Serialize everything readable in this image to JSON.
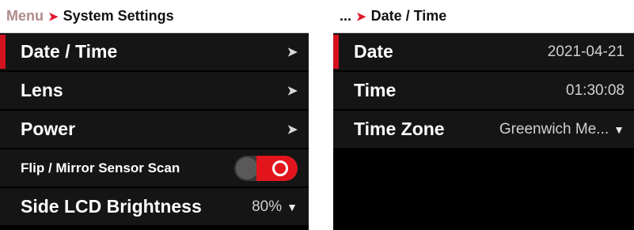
{
  "left": {
    "breadcrumb": {
      "root": "Menu",
      "separator": "➤",
      "current": "System Settings"
    },
    "items": [
      {
        "label": "Date / Time",
        "chevron": "➤"
      },
      {
        "label": "Lens",
        "chevron": "➤"
      },
      {
        "label": "Power",
        "chevron": "➤"
      },
      {
        "label": "Flip / Mirror Sensor Scan",
        "toggle_on": true
      },
      {
        "label": "Side LCD Brightness",
        "value": "80%",
        "dropdown": "▼"
      }
    ]
  },
  "right": {
    "breadcrumb": {
      "root": "...",
      "separator": "➤",
      "current": "Date / Time"
    },
    "items": [
      {
        "label": "Date",
        "value": "2021-04-21"
      },
      {
        "label": "Time",
        "value": "01:30:08"
      },
      {
        "label": "Time Zone",
        "value": "Greenwich Me...",
        "dropdown": "▼"
      }
    ]
  },
  "colors": {
    "accent": "#d4121f",
    "row_bg": "#151515",
    "background": "#000000"
  }
}
